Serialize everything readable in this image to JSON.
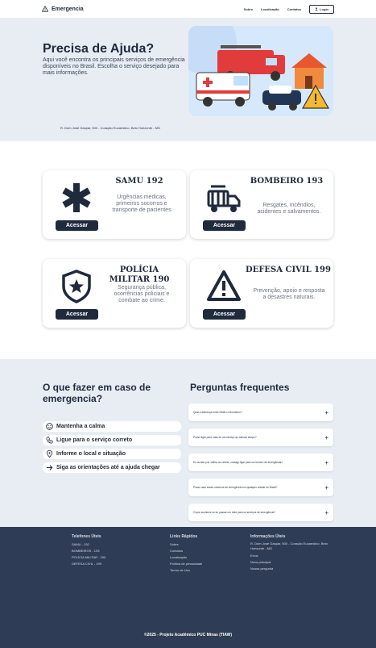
{
  "nav": {
    "brand": "Emergencia",
    "links": [
      "Sobre",
      "Localização",
      "Contatos"
    ],
    "login": "Login"
  },
  "hero": {
    "title": "Precisa de Ajuda?",
    "description": "Aqui você encontra os principais serviços de emergência disponíveis no Brasil. Escolha o serviço desejado para mais informações.",
    "address": "R. Dom José Gaspar, 500 - Coração Eucarístico, Belo Horizonte - MG"
  },
  "services": [
    {
      "title": "SAMU 192",
      "description": "Urgências médicas, primeiros socorros e transporte de pacientes",
      "button": "Acessar",
      "icon": "medical-star-icon"
    },
    {
      "title": "BOMBEIRO 193",
      "description": "Resgates, incêndios, acidentes e salvamentos.",
      "button": "Acessar",
      "icon": "fire-truck-icon"
    },
    {
      "title": "POLÍCIA MILITAR 190",
      "description": "Segurança pública, ocorrências policiais e combate ao crime.",
      "button": "Acessar",
      "icon": "police-shield-icon"
    },
    {
      "title": "DEFESA CIVIL 199",
      "description": "Prevenção, apoio e resposta a desastres naturais.",
      "button": "Acessar",
      "icon": "warning-triangle-icon"
    }
  ],
  "help": {
    "title": "O que fazer em caso de emergencia?",
    "steps": [
      {
        "label": "Mantenha a calma",
        "icon": "calm-icon"
      },
      {
        "label": "Ligue para o serviço correto",
        "icon": "phone-icon"
      },
      {
        "label": "Informe o local e situação",
        "icon": "location-icon"
      },
      {
        "label": "Siga as orientações até a ajuda chegar",
        "icon": "arrow-right-icon"
      }
    ]
  },
  "faq": {
    "title": "Perguntas frequentes",
    "items": [
      "Qual a diferença entre SAMU e Bombeiro?",
      "Posso ligar para mais de um serviço ao mesmo tempo?",
      "Eu ouvido (ver vítima no celular, consigo ligar para os número de emergência?",
      "Posso usar esses números de emergência em qualquer cidade do Brasil?",
      "O que acontece se eu passar um trote para os serviços de emergência?"
    ]
  },
  "footer": {
    "phones_title": "Telefones Úteis",
    "phones": [
      "SAMU - 192",
      "BOMBEIROS - 193",
      "POLÍCIA MILITAR - 190",
      "DEFESA CIVIL - 199"
    ],
    "links_title": "Links Rápidos",
    "links": [
      "Sobre",
      "Contatos",
      "Localização",
      "Política de privacidade",
      "Termo de Uso"
    ],
    "info_title": "Informações Úteis",
    "info_address": "R. Dom José Gaspar, 500 - Coração Eucarístico, Belo Horizonte - MG",
    "info_links": [
      "Erros",
      "Nova principal",
      "Nossa pergunta"
    ],
    "copyright": "©2025 - Projeto Acadêmico PUC Minas (TIAW)"
  },
  "colors": {
    "primary": "#1f2a3c",
    "hero_bg": "#e8edf4",
    "footer_bg": "#2e3c56"
  }
}
